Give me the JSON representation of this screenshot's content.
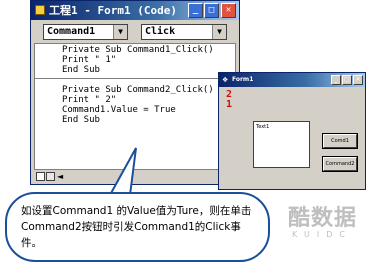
{
  "code_window": {
    "title": "工程1 - Form1 (Code)",
    "object_combo": "Command1",
    "event_combo": "Click",
    "code_lines": [
      "Private Sub Command1_Click()",
      "Print \" 1\"",
      "End Sub",
      "Private Sub Command2_Click()",
      "Print \" 2\"",
      "Command1.Value = True",
      "End Sub"
    ]
  },
  "form_window": {
    "title": "Form1",
    "output": [
      "2",
      "1"
    ],
    "textbox_text": "Text1",
    "button1_label": "Comd1",
    "button2_label": "Command2"
  },
  "callout": {
    "text": "如设置Command1 的Value值为Ture，则在单击Command2按钮时引发Command1的Click事件。"
  },
  "watermark": {
    "text": "酷数据",
    "sub": "KUIDC"
  }
}
